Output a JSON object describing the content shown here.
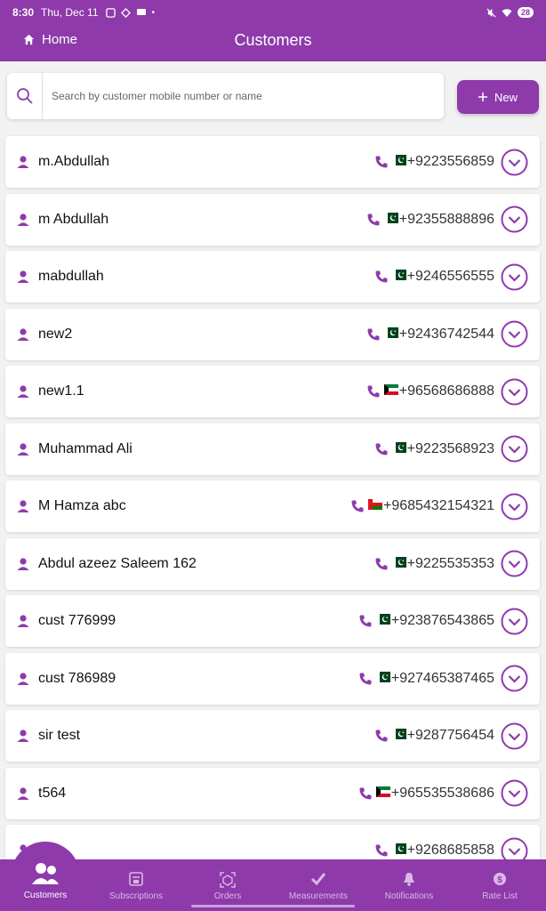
{
  "status_bar": {
    "time": "8:30",
    "date": "Thu, Dec 11",
    "battery": "28"
  },
  "app_bar": {
    "home_label": "Home",
    "title": "Customers"
  },
  "search": {
    "placeholder": "Search by customer mobile number or name",
    "value": ""
  },
  "new_button": {
    "label": "New",
    "icon": "plus-icon"
  },
  "colors": {
    "primary": "#8e3aab",
    "pk_green": "#01411c",
    "kw_green": "#007a3d",
    "kw_red": "#ce1126",
    "om_red": "#db161b"
  },
  "customers": [
    {
      "name": "m.Abdullah",
      "phone": "+9223556859",
      "flag": "pk"
    },
    {
      "name": "m Abdullah",
      "phone": "+92355888896",
      "flag": "pk"
    },
    {
      "name": "mabdullah",
      "phone": "+9246556555",
      "flag": "pk"
    },
    {
      "name": "new2",
      "phone": "+92436742544",
      "flag": "pk"
    },
    {
      "name": "new1.1",
      "phone": "+96568686888",
      "flag": "kw"
    },
    {
      "name": "Muhammad Ali",
      "phone": "+9223568923",
      "flag": "pk"
    },
    {
      "name": "M Hamza abc",
      "phone": "+9685432154321",
      "flag": "om"
    },
    {
      "name": "Abdul azeez Saleem 162",
      "phone": "+9225535353",
      "flag": "pk"
    },
    {
      "name": "cust 776999",
      "phone": "+923876543865",
      "flag": "pk"
    },
    {
      "name": "cust 786989",
      "phone": "+927465387465",
      "flag": "pk"
    },
    {
      "name": "sir test",
      "phone": "+9287756454",
      "flag": "pk"
    },
    {
      "name": "t564",
      "phone": "+965535538686",
      "flag": "kw"
    },
    {
      "name": "",
      "phone": "+9268685858",
      "flag": "pk"
    }
  ],
  "bottom_nav": [
    {
      "label": "Customers",
      "icon": "people-icon",
      "active": true
    },
    {
      "label": "Subscriptions",
      "icon": "subscriptions-icon",
      "active": false
    },
    {
      "label": "Orders",
      "icon": "orders-icon",
      "active": false
    },
    {
      "label": "Measurements",
      "icon": "check-icon",
      "active": false
    },
    {
      "label": "Notifications",
      "icon": "bell-icon",
      "active": false
    },
    {
      "label": "Rate List",
      "icon": "dollar-icon",
      "active": false
    }
  ]
}
